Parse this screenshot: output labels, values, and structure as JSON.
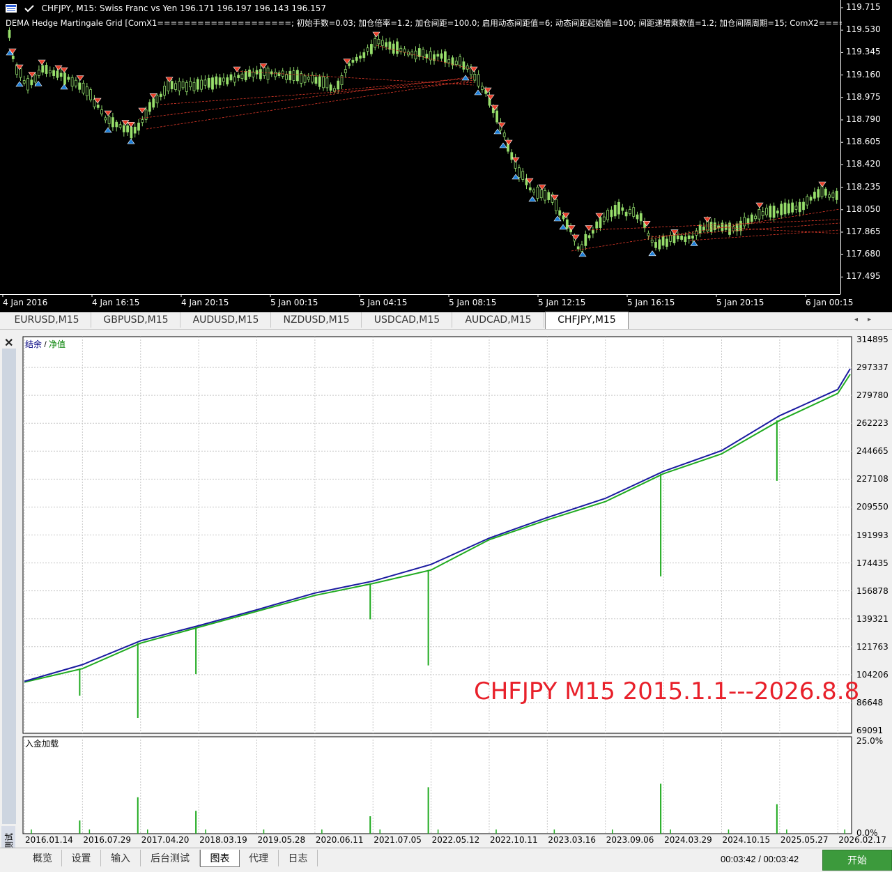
{
  "chart": {
    "symbol_title": "CHFJPY, M15:  Swiss Franc vs Yen  196.171 196.197 196.143 196.157",
    "indicator_text": "DEMA Hedge Martingale Grid [ComX1====================; 初始手数=0.03; 加仓倍率=1.2; 加仓间距=100.0; 启用动态间距值=6; 动态间距起始值=100; 间距递增乘数值=1.2; 加仓间隔周期=15; ComX2====",
    "price_labels": [
      "119.715",
      "119.530",
      "119.345",
      "119.160",
      "118.975",
      "118.790",
      "118.605",
      "118.420",
      "118.235",
      "118.050",
      "117.865",
      "117.680",
      "117.495"
    ],
    "time_labels": [
      "4 Jan 2016",
      "4 Jan 16:15",
      "4 Jan 20:15",
      "5 Jan 00:15",
      "5 Jan 04:15",
      "5 Jan 08:15",
      "5 Jan 12:15",
      "5 Jan 16:15",
      "5 Jan 20:15",
      "6 Jan 00:15"
    ],
    "colors": {
      "bull": "#9adf6a",
      "bear": "#000000",
      "wick": "#8fd96a",
      "buy_arrow": "#1e7fd8",
      "sell_arrow": "#e8402a",
      "grid_line": "#e03a2a"
    }
  },
  "symbol_tabs": [
    "EURUSD,M15",
    "GBPUSD,M15",
    "AUDUSD,M15",
    "NZDUSD,M15",
    "USDCAD,M15",
    "AUDCAD,M15",
    "CHFJPY,M15"
  ],
  "active_symbol_tab": "CHFJPY,M15",
  "tester": {
    "legend_balance": "结余",
    "legend_sep": " / ",
    "legend_equity": "净值",
    "load_label": "入金加载",
    "annotation": "CHFJPY M15 2015.1.1---2026.8.8",
    "side_label": "策略测试",
    "y_labels": [
      "314895",
      "297337",
      "279780",
      "262223",
      "244665",
      "227108",
      "209550",
      "191993",
      "174435",
      "156878",
      "139321",
      "121763",
      "104206",
      "86648",
      "69091"
    ],
    "load_labels": [
      "25.0%",
      "0.0%"
    ],
    "date_labels": [
      "2016.01.14",
      "2016.07.29",
      "2017.04.20",
      "2018.03.19",
      "2019.05.28",
      "2020.06.11",
      "2021.07.05",
      "2022.05.12",
      "2022.10.11",
      "2023.03.16",
      "2023.09.06",
      "2024.03.29",
      "2024.10.15",
      "2025.05.27",
      "2026.02.17"
    ],
    "colors": {
      "balance": "#1a1aa0",
      "equity": "#1faa1f",
      "load": "#1faa1f"
    }
  },
  "chart_data": {
    "type": "line",
    "title": "",
    "xlabel": "",
    "ylabel": "",
    "ylim": [
      69091,
      314895
    ],
    "x": [
      "2016.01.14",
      "2016.07.29",
      "2017.04.20",
      "2018.03.19",
      "2019.05.28",
      "2020.06.11",
      "2021.07.05",
      "2022.05.12",
      "2022.10.11",
      "2023.03.16",
      "2023.09.06",
      "2024.03.29",
      "2024.10.15",
      "2025.05.27",
      "2026.02.17"
    ],
    "series": [
      {
        "name": "结余",
        "values": [
          100000,
          110500,
          125500,
          135000,
          145000,
          155500,
          163000,
          173500,
          190000,
          203000,
          215000,
          232000,
          245000,
          267000,
          283500
        ]
      },
      {
        "name": "净值",
        "values": [
          99500,
          108000,
          124000,
          134000,
          144000,
          154000,
          161500,
          170000,
          189000,
          201500,
          213000,
          230500,
          243000,
          264000,
          281000
        ]
      }
    ],
    "equity_dips": [
      {
        "date": "2016.07.29",
        "value": 91000
      },
      {
        "date": "2017.04.20",
        "value": 77000
      },
      {
        "date": "2018.03.19",
        "value": 104500
      },
      {
        "date": "2021.07.05",
        "value": 139000
      },
      {
        "date": "2022.05.12",
        "value": 110000
      },
      {
        "date": "2024.03.29",
        "value": 166000
      },
      {
        "date": "2025.05.27",
        "value": 226000
      }
    ],
    "load_ylim": [
      0,
      25.0
    ],
    "grid": true,
    "legend": "top-left"
  }
}
